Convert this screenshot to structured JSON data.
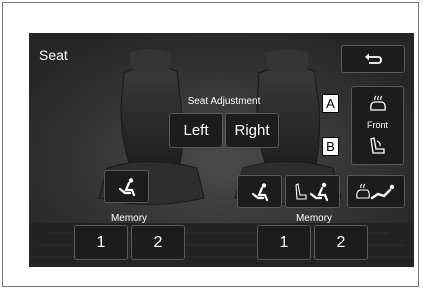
{
  "screen": {
    "title": "Seat"
  },
  "back_button": {
    "icon": "back-arrow-icon"
  },
  "seat_adjustment": {
    "label": "Seat Adjustment",
    "left_label": "Left",
    "right_label": "Right"
  },
  "front_panel": {
    "label": "Front",
    "top_icon": "seat-heater-icon",
    "bottom_icon": "seat-recline-icon"
  },
  "callouts": {
    "a": "A",
    "b": "B"
  },
  "left_memory": {
    "label": "Memory",
    "buttons": [
      "1",
      "2"
    ],
    "position_icon": "seat-position-icon"
  },
  "right_memory": {
    "label": "Memory",
    "buttons": [
      "1",
      "2"
    ],
    "position_icon": "seat-position-icon"
  },
  "right_icons": [
    "seat-position-icon",
    "seat-move-icon",
    "seat-easy-access-icon"
  ],
  "colors": {
    "screen_bg": "#2c2c2c",
    "button_bg": "#1c1c1c",
    "button_border": "#5a5a5a",
    "text": "#ffffff"
  }
}
